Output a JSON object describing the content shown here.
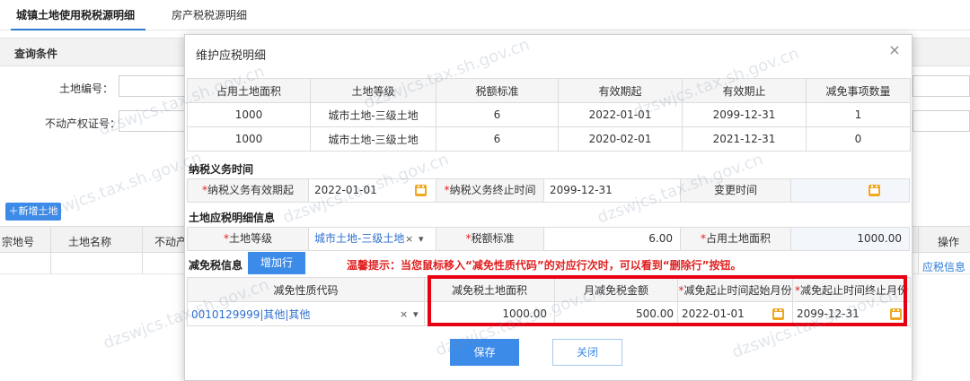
{
  "top_tabs": {
    "tab1": "城镇土地使用税税源明细",
    "tab2": "房产税税源明细"
  },
  "query": {
    "title": "查询条件",
    "land_no_label": "土地编号：",
    "cert_no_label": "不动产权证号："
  },
  "add_land_button": "＋新增土地",
  "bg_table": {
    "headers": [
      "宗地号",
      "土地名称",
      "不动产",
      "操作"
    ],
    "op_link": "应税信息"
  },
  "modal": {
    "title": "维护应税明细",
    "close": "×",
    "top_table": {
      "headers": [
        "占用土地面积",
        "土地等级",
        "税额标准",
        "有效期起",
        "有效期止",
        "减免事项数量"
      ],
      "rows": [
        [
          "1000",
          "城市土地-三级土地",
          "6",
          "2022-01-01",
          "2099-12-31",
          "1"
        ],
        [
          "1000",
          "城市土地-三级土地",
          "6",
          "2020-02-01",
          "2021-12-31",
          "0"
        ]
      ]
    },
    "tax_period": {
      "section": "纳税义务时间",
      "start_label": "纳税义务有效期起",
      "start_value": "2022-01-01",
      "end_label": "纳税义务终止时间",
      "end_value": "2099-12-31",
      "change_label": "变更时间"
    },
    "detail": {
      "section": "土地应税明细信息",
      "grade_label": "土地等级",
      "grade_value": "城市土地-三级土地",
      "rate_label": "税额标准",
      "rate_value": "6.00",
      "area_label": "占用土地面积",
      "area_value": "1000.00"
    },
    "relief": {
      "section": "减免税信息",
      "add_row": "增加行",
      "tip": "温馨提示：当您鼠标移入“减免性质代码”的对应行次时，可以看到“删除行”按钮。",
      "headers": [
        "减免性质代码",
        "减免税土地面积",
        "月减免税金额",
        "减免起止时间起始月份",
        "减免起止时间终止月份"
      ],
      "row": {
        "code": "0010129999|其他|其他",
        "area": "1000.00",
        "monthly": "500.00",
        "start": "2022-01-01",
        "end": "2099-12-31"
      }
    },
    "save": "保存",
    "close_btn": "关闭"
  },
  "required_mark": "*",
  "clear_mark": "×",
  "dropdown_mark": "▾",
  "watermark": "dzswjcs.tax.sh.gov.cn",
  "colors": {
    "accent": "#3d8be8",
    "tip_red": "#e02020",
    "highlight_box": "#e60012",
    "calendar": "#f0a823"
  }
}
